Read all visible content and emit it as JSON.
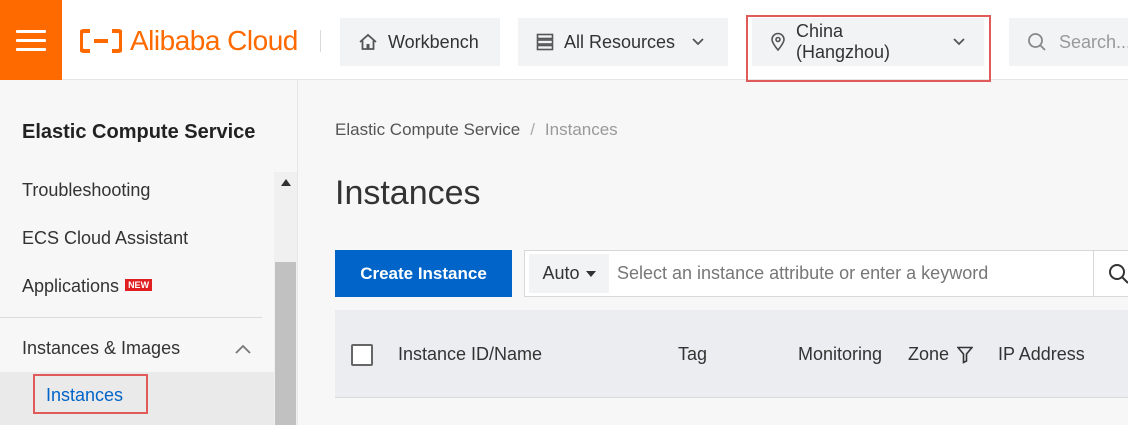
{
  "header": {
    "logo_text": "Alibaba Cloud",
    "workbench_label": "Workbench",
    "resources_label": "All Resources",
    "region_label": "China (Hangzhou)",
    "search_placeholder": "Search..."
  },
  "sidebar": {
    "title": "Elastic Compute Service",
    "items": [
      {
        "label": "Troubleshooting"
      },
      {
        "label": "ECS Cloud Assistant"
      },
      {
        "label": "Applications",
        "badge": "NEW"
      }
    ],
    "group": {
      "label": "Instances & Images",
      "active_item": "Instances"
    }
  },
  "main": {
    "breadcrumb": [
      "Elastic Compute Service",
      "Instances"
    ],
    "title": "Instances",
    "create_button": "Create Instance",
    "filter": {
      "mode": "Auto",
      "placeholder": "Select an instance attribute or enter a keyword"
    },
    "table": {
      "columns": [
        "Instance ID/Name",
        "Tag",
        "Monitoring",
        "Zone",
        "IP Address"
      ]
    }
  },
  "colors": {
    "brand": "#ff6a00",
    "primary": "#0064c8",
    "highlight": "#e05a5a"
  }
}
